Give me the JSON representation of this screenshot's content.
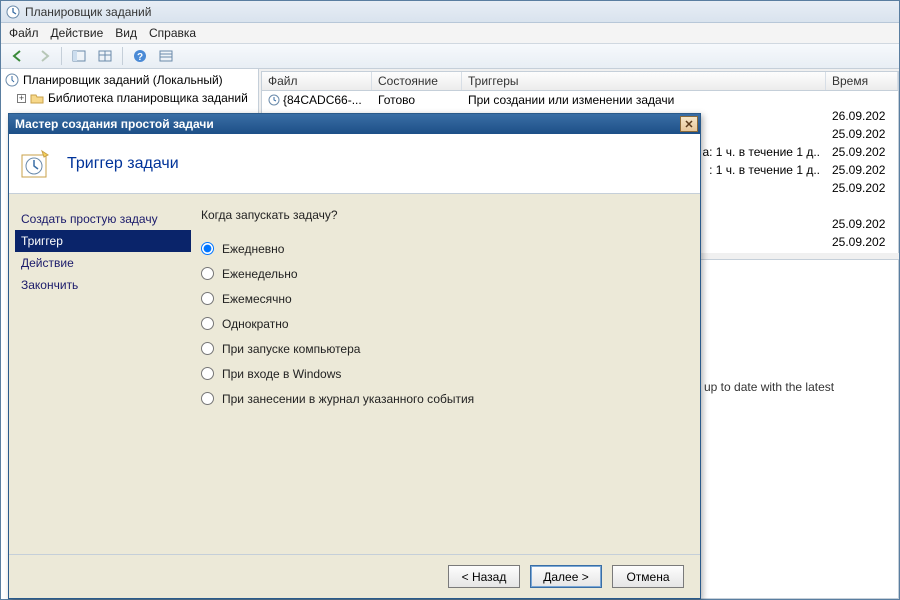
{
  "window": {
    "title": "Планировщик заданий"
  },
  "menu": {
    "file": "Файл",
    "action": "Действие",
    "view": "Вид",
    "help": "Справка"
  },
  "tree": {
    "root": "Планировщик заданий (Локальный)",
    "child": "Библиотека планировщика заданий"
  },
  "list": {
    "headers": {
      "file": "Файл",
      "state": "Состояние",
      "triggers": "Триггеры",
      "time": "Время сле"
    },
    "rows": [
      {
        "file": "{84CADC66-...",
        "state": "Готово",
        "trigger": "При создании или изменении задачи",
        "time": ""
      }
    ],
    "partial": [
      {
        "trigger": "",
        "time": "26.09.202"
      },
      {
        "trigger": "",
        "time": "25.09.202"
      },
      {
        "trigger": "а: 1 ч. в течение 1 д..",
        "time": "25.09.202"
      },
      {
        "trigger": ": 1 ч. в течение 1 д..",
        "time": "25.09.202"
      },
      {
        "trigger": "",
        "time": "25.09.202"
      },
      {
        "trigger": "",
        "time": ""
      },
      {
        "trigger": "",
        "time": "25.09.202"
      },
      {
        "trigger": "",
        "time": "25.09.202"
      }
    ]
  },
  "info_fragment": "is up to date with the latest",
  "dialog": {
    "title": "Мастер создания простой задачи",
    "header": "Триггер задачи",
    "steps": {
      "create": "Создать простую задачу",
      "trigger": "Триггер",
      "action": "Действие",
      "finish": "Закончить"
    },
    "prompt": "Когда запускать задачу?",
    "options": {
      "daily": "Ежедневно",
      "weekly": "Еженедельно",
      "monthly": "Ежемесячно",
      "once": "Однократно",
      "startup": "При запуске компьютера",
      "logon": "При входе в Windows",
      "event": "При занесении в журнал указанного события"
    },
    "buttons": {
      "back": "< Назад",
      "next": "Далее >",
      "cancel": "Отмена"
    }
  }
}
